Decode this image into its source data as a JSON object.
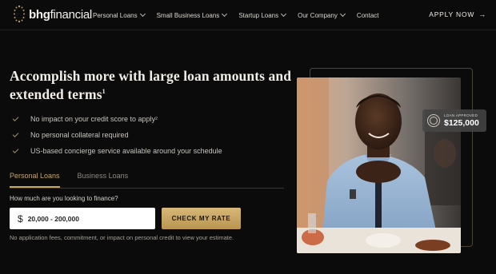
{
  "brand": {
    "logo_bold": "bhg",
    "logo_light": "financial",
    "accent_color": "#c7a765"
  },
  "nav": {
    "items": [
      {
        "label": "Personal Loans",
        "dropdown": true
      },
      {
        "label": "Small Business Loans",
        "dropdown": true
      },
      {
        "label": "Startup Loans",
        "dropdown": true
      },
      {
        "label": "Our Company",
        "dropdown": true
      },
      {
        "label": "Contact",
        "dropdown": false
      }
    ],
    "apply_label": "APPLY NOW",
    "apply_icon": "arrow-right-icon"
  },
  "hero": {
    "headline": "Accomplish more with large loan amounts and extended terms",
    "headline_sup": "1",
    "bullets": [
      {
        "text": "No impact on your credit score to apply",
        "sup": "2"
      },
      {
        "text": "No personal collateral required",
        "sup": ""
      },
      {
        "text": "US-based concierge service available around your schedule",
        "sup": ""
      }
    ],
    "tabs": [
      {
        "label": "Personal Loans",
        "active": true
      },
      {
        "label": "Business Loans",
        "active": false
      }
    ],
    "question": "How much are you looking to finance?",
    "amount_symbol": "$",
    "amount_value": "20,000 - 200,000",
    "cta_label": "CHECK MY RATE",
    "disclaimer": "No application fees, commitment, or impact on personal credit to view your estimate."
  },
  "badge": {
    "label": "LOAN APPROVED",
    "amount": "$125,000"
  }
}
